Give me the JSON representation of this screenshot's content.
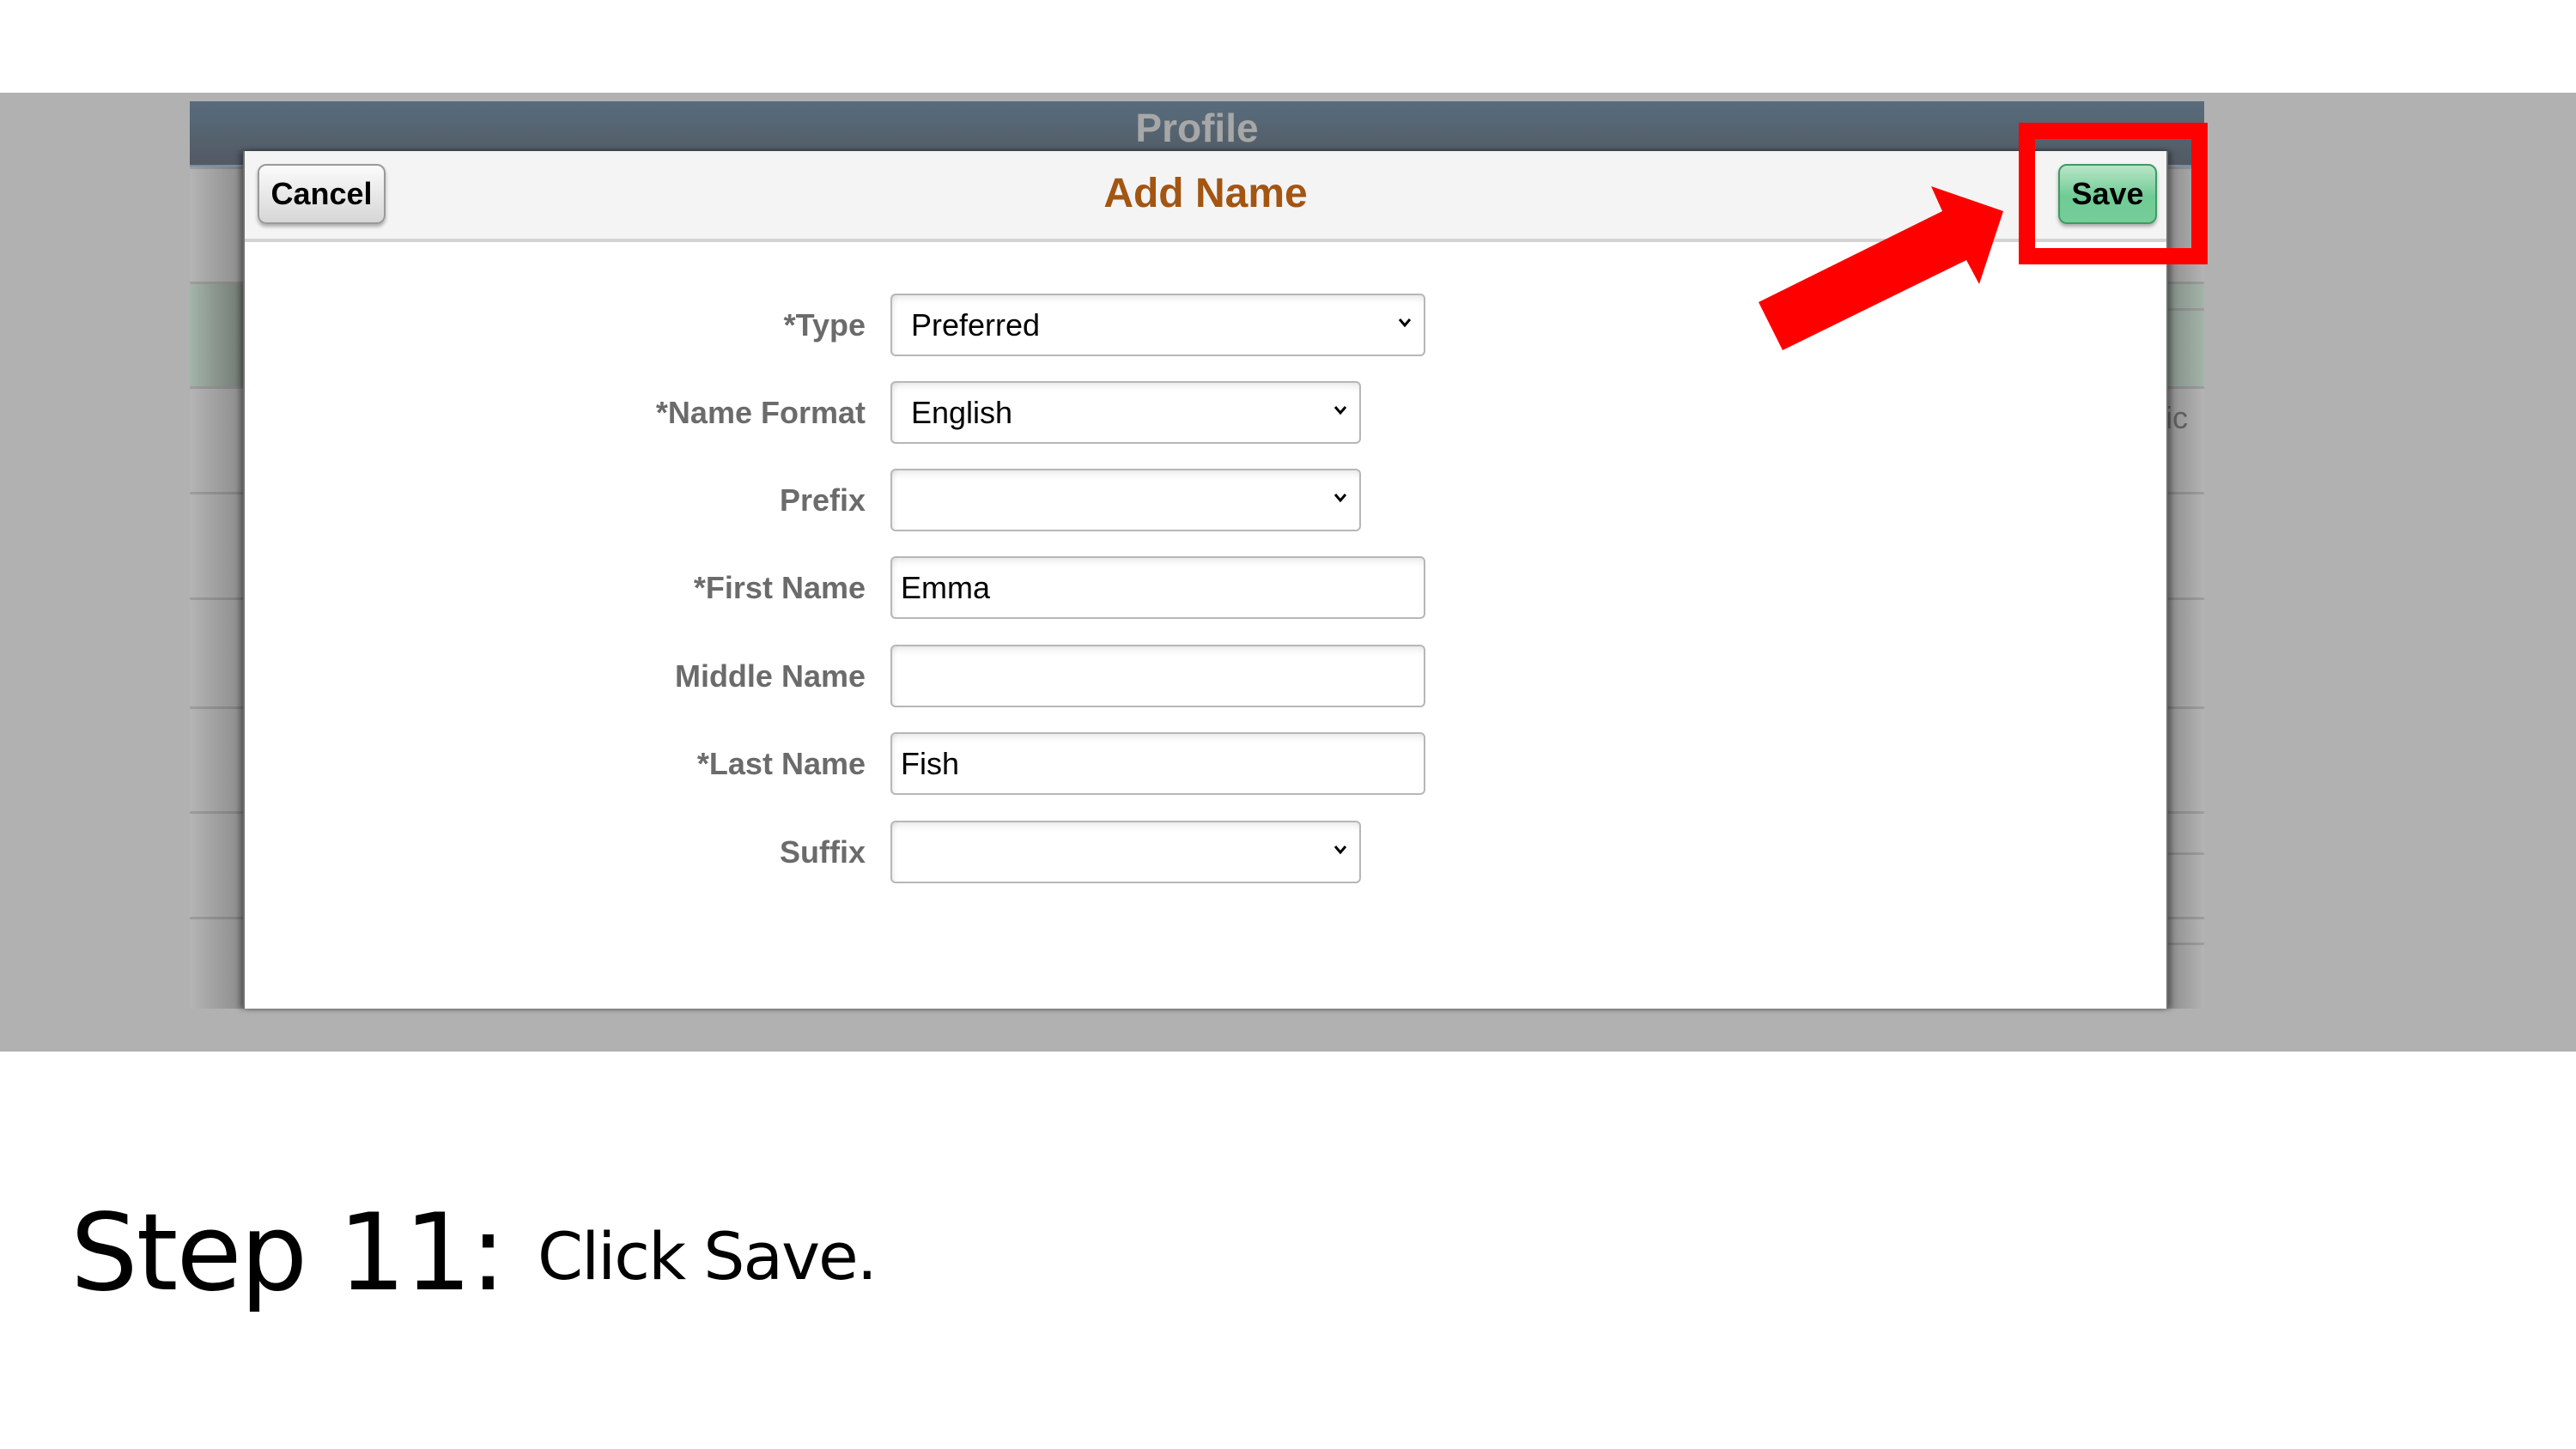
{
  "background_page": {
    "title": "Profile",
    "partial_text_right": "ic"
  },
  "modal": {
    "title": "Add Name",
    "cancel_label": "Cancel",
    "save_label": "Save",
    "fields": [
      {
        "label": "*Type",
        "kind": "select",
        "value": "Preferred"
      },
      {
        "label": "*Name Format",
        "kind": "select",
        "value": "English"
      },
      {
        "label": "Prefix",
        "kind": "select",
        "value": ""
      },
      {
        "label": "*First Name",
        "kind": "text",
        "value": "Emma"
      },
      {
        "label": "Middle Name",
        "kind": "text",
        "value": ""
      },
      {
        "label": "*Last Name",
        "kind": "text",
        "value": "Fish"
      },
      {
        "label": "Suffix",
        "kind": "select",
        "value": ""
      }
    ]
  },
  "annotation": {
    "target": "save-button",
    "highlight_color": "#ff0000"
  },
  "caption": {
    "step": "Step 11:",
    "instruction": "Click Save."
  },
  "colors": {
    "title_accent": "#a35512",
    "save_button_green": "#6fcb95",
    "header_slate": "#586c7d"
  }
}
